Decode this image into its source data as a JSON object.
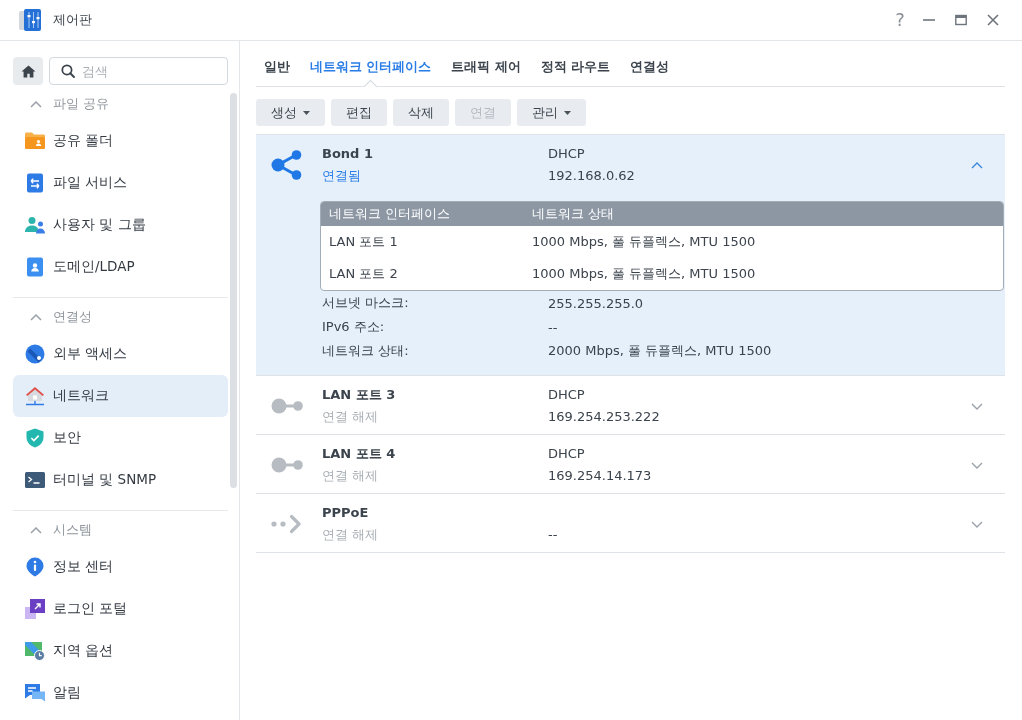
{
  "window": {
    "title": "제어판",
    "help": "?"
  },
  "sidebar": {
    "search": {
      "placeholder": "검색"
    },
    "sections": [
      {
        "title": "파일 공유",
        "expanded": true,
        "items": [
          {
            "label": "공유 폴더",
            "kind": "folder",
            "selected": false
          },
          {
            "label": "파일 서비스",
            "kind": "transfer",
            "selected": false
          },
          {
            "label": "사용자 및 그룹",
            "kind": "users",
            "selected": false
          },
          {
            "label": "도메인/LDAP",
            "kind": "directory",
            "selected": false
          }
        ]
      },
      {
        "title": "연결성",
        "expanded": true,
        "items": [
          {
            "label": "외부 액세스",
            "kind": "globe",
            "selected": false
          },
          {
            "label": "네트워크",
            "kind": "network",
            "selected": true
          },
          {
            "label": "보안",
            "kind": "shield",
            "selected": false
          },
          {
            "label": "터미널 및 SNMP",
            "kind": "terminal",
            "selected": false
          }
        ]
      },
      {
        "title": "시스템",
        "expanded": true,
        "items": [
          {
            "label": "정보 센터",
            "kind": "info",
            "selected": false
          },
          {
            "label": "로그인 포털",
            "kind": "portal",
            "selected": false
          },
          {
            "label": "지역 옵션",
            "kind": "region",
            "selected": false
          },
          {
            "label": "알림",
            "kind": "notification",
            "selected": false
          }
        ]
      }
    ]
  },
  "tabs": [
    {
      "label": "일반",
      "selected": false
    },
    {
      "label": "네트워크 인터페이스",
      "selected": true
    },
    {
      "label": "트래픽 제어",
      "selected": false
    },
    {
      "label": "정적 라우트",
      "selected": false
    },
    {
      "label": "연결성",
      "selected": false
    }
  ],
  "toolbar": [
    {
      "label": "생성",
      "dropdown": true,
      "disabled": false
    },
    {
      "label": "편집",
      "dropdown": false,
      "disabled": false
    },
    {
      "label": "삭제",
      "dropdown": false,
      "disabled": false
    },
    {
      "label": "연결",
      "dropdown": false,
      "disabled": true
    },
    {
      "label": "관리",
      "dropdown": true,
      "disabled": false
    }
  ],
  "interfaces": [
    {
      "kind": "bond",
      "name": "Bond 1",
      "status": "연결됨",
      "connected": true,
      "mode": "DHCP",
      "address": "192.168.0.62",
      "selected": true,
      "expanded": true,
      "members": {
        "columns": [
          "네트워크 인터페이스",
          "네트워크 상태"
        ],
        "rows": [
          [
            "LAN 포트 1",
            "1000 Mbps, 풀 듀플렉스, MTU 1500"
          ],
          [
            "LAN 포트 2",
            "1000 Mbps, 풀 듀플렉스, MTU 1500"
          ]
        ]
      },
      "details": [
        {
          "label": "서브넷 마스크:",
          "value": "255.255.255.0"
        },
        {
          "label": "IPv6 주소:",
          "value": "--"
        },
        {
          "label": "네트워크 상태:",
          "value": "2000 Mbps, 풀 듀플렉스, MTU 1500"
        }
      ]
    },
    {
      "kind": "lan",
      "name": "LAN 포트 3",
      "status": "연결 해제",
      "connected": false,
      "mode": "DHCP",
      "address": "169.254.253.222",
      "selected": false,
      "expanded": false
    },
    {
      "kind": "lan",
      "name": "LAN 포트 4",
      "status": "연결 해제",
      "connected": false,
      "mode": "DHCP",
      "address": "169.254.14.173",
      "selected": false,
      "expanded": false
    },
    {
      "kind": "pppoe",
      "name": "PPPoE",
      "status": "연결 해제",
      "connected": false,
      "address": "--",
      "selected": false,
      "expanded": false
    }
  ]
}
